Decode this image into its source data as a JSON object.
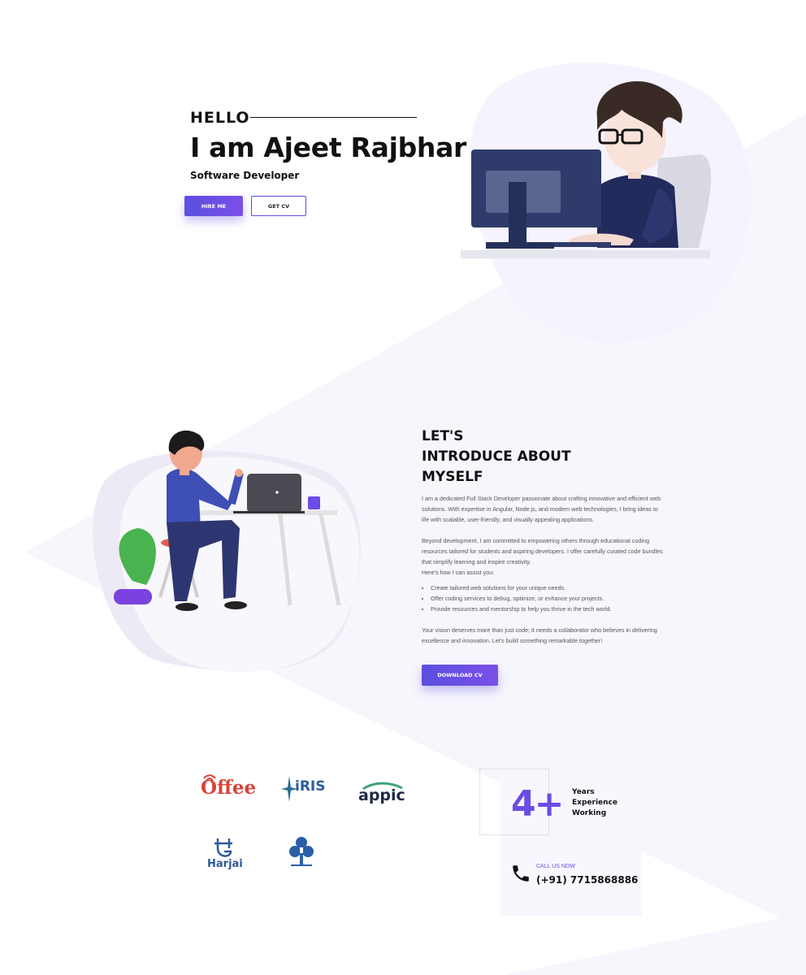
{
  "hero": {
    "greeting": "HELLO",
    "name": "I am Ajeet Rajbhar",
    "role": "Software Developer",
    "hire_label": "HIRE ME",
    "cv_label": "GET CV"
  },
  "about": {
    "title_line1": "LET'S",
    "title_line2": "INTRODUCE ABOUT",
    "title_line3": "MYSELF",
    "p1_a": "I am a dedicated ",
    "p1_highlight": "Full Stack Developer",
    "p1_b": " passionate about crafting innovative and efficient web solutions. With expertise in Angular, Node.js, and modern web technologies, I bring ideas to life with scalable, user-friendly, and visually appealing applications.",
    "p2": "Beyond development, I am committed to empowering others through educational coding resources tailored for students and aspiring developers. I offer carefully curated code bundles that simplify learning and inspire creativity.",
    "p2_intro": "Here's how I can assist you:",
    "bullets": [
      "Create tailored web solutions for your unique needs.",
      "Offer coding services to debug, optimize, or enhance your projects.",
      "Provide resources and mentorship to help you thrive in the tech world."
    ],
    "p3": "Your vision deserves more than just code; it needs a collaborator who believes in delivering excellence and innovation. Let's build something remarkable together!",
    "download_label": "DOWNLOAD CV"
  },
  "clients": {
    "logos": [
      "Offee",
      "iRIS",
      "appic",
      "Harjai"
    ]
  },
  "experience": {
    "number": "4+",
    "line1": "Years",
    "line2": "Experience",
    "line3": "Working",
    "call_label": "CALL US NOW",
    "phone": "(+91) 7715868886"
  },
  "colors": {
    "accent": "#6b4de6",
    "button_gradient_start": "#5b4fe0",
    "background_shape": "#f7f6fd"
  }
}
